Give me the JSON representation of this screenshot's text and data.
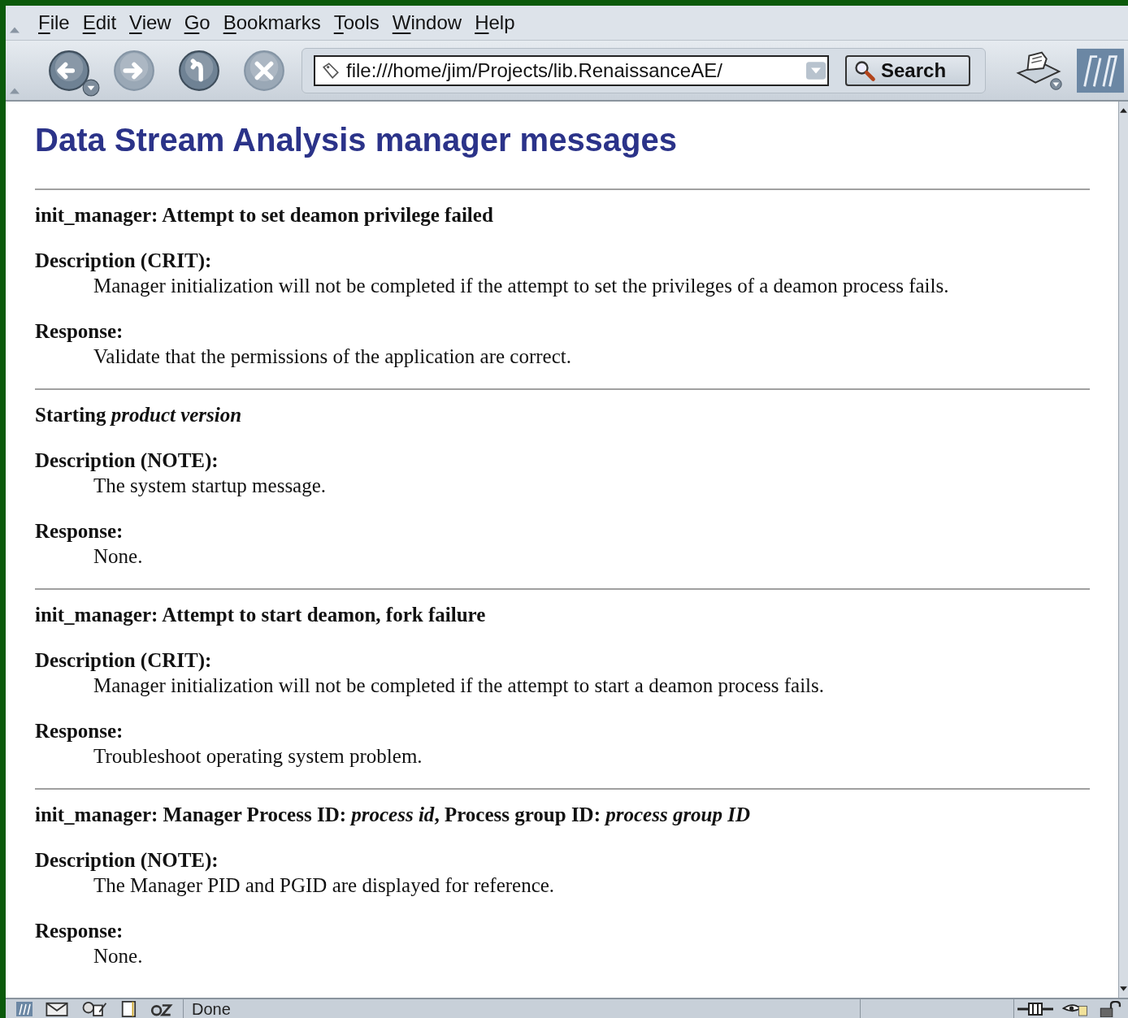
{
  "menu_bar": [
    "File",
    "Edit",
    "View",
    "Go",
    "Bookmarks",
    "Tools",
    "Window",
    "Help"
  ],
  "navigation": {
    "back": {
      "disabled": false
    },
    "forward": {
      "disabled": true
    },
    "reload": {
      "disabled": false
    },
    "stop": {
      "disabled": true
    }
  },
  "address_bar": {
    "value": "file:///home/jim/Projects/lib.RenaissanceAE/"
  },
  "search_button": "Search",
  "page": {
    "title": "Data Stream Analysis manager messages",
    "messages": [
      {
        "title": "init_manager: Attempt to set deamon privilege failed",
        "description_label": "Description (CRIT):",
        "description": "Manager initialization will not be completed if the attempt to set the privileges of a deamon process fails.",
        "response_label": "Response:",
        "response": "Validate that the permissions of the application are correct."
      },
      {
        "title": "Starting *product version*",
        "description_label": "Description (NOTE):",
        "description": "The system startup message.",
        "response_label": "Response:",
        "response": "None."
      },
      {
        "title": "init_manager: Attempt to start deamon, fork failure",
        "description_label": "Description (CRIT):",
        "description": "Manager initialization will not be completed if the attempt to start a deamon process fails.",
        "response_label": "Response:",
        "response": "Troubleshoot operating system problem."
      },
      {
        "title": "init_manager: Manager Process ID: *process id*, Process group ID: *process group ID*",
        "description_label": "Description (NOTE):",
        "description": "The Manager PID and PGID are displayed for reference.",
        "response_label": "Response:",
        "response": "None."
      }
    ]
  },
  "status_bar": {
    "text": "Done"
  }
}
